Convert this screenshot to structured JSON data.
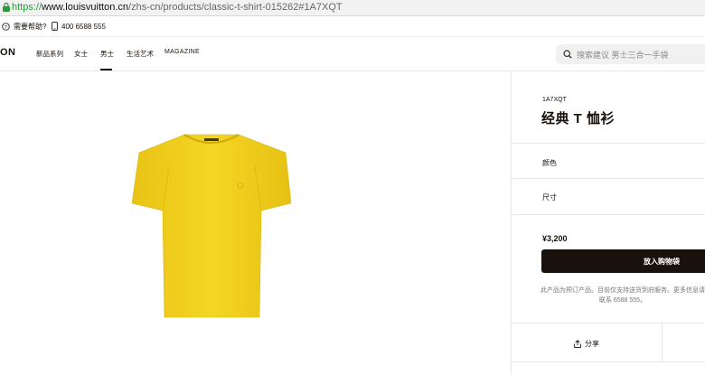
{
  "browser": {
    "url_scheme": "https://",
    "url_host": "www.louisvuitton.cn",
    "url_path": "/zhs-cn/products/classic-t-shirt-015262#1A7XQT"
  },
  "utility": {
    "help_label": "需要帮助?",
    "phone": "400 6588 555"
  },
  "nav": {
    "logo": "ON",
    "items": [
      "新品系列",
      "女士",
      "男士",
      "生活艺术",
      "MAGAZINE"
    ],
    "active": "男士",
    "search_placeholder": "搜索建议 男士三合一手袋"
  },
  "product": {
    "sku": "1A7XQT",
    "title": "经典 T 恤衫",
    "color_label": "颜色",
    "size_label": "尺寸",
    "price": "¥3,200",
    "add_to_bag": "放入购物袋",
    "notice": "此产品为预订产品。目前仅支持送货到府服务。更多信息请联系 6588 555。",
    "share": "分享",
    "image_color": "#f2d01f"
  },
  "colors": {
    "brand_dark": "#19110b",
    "tshirt_yellow": "#f2d01f"
  }
}
